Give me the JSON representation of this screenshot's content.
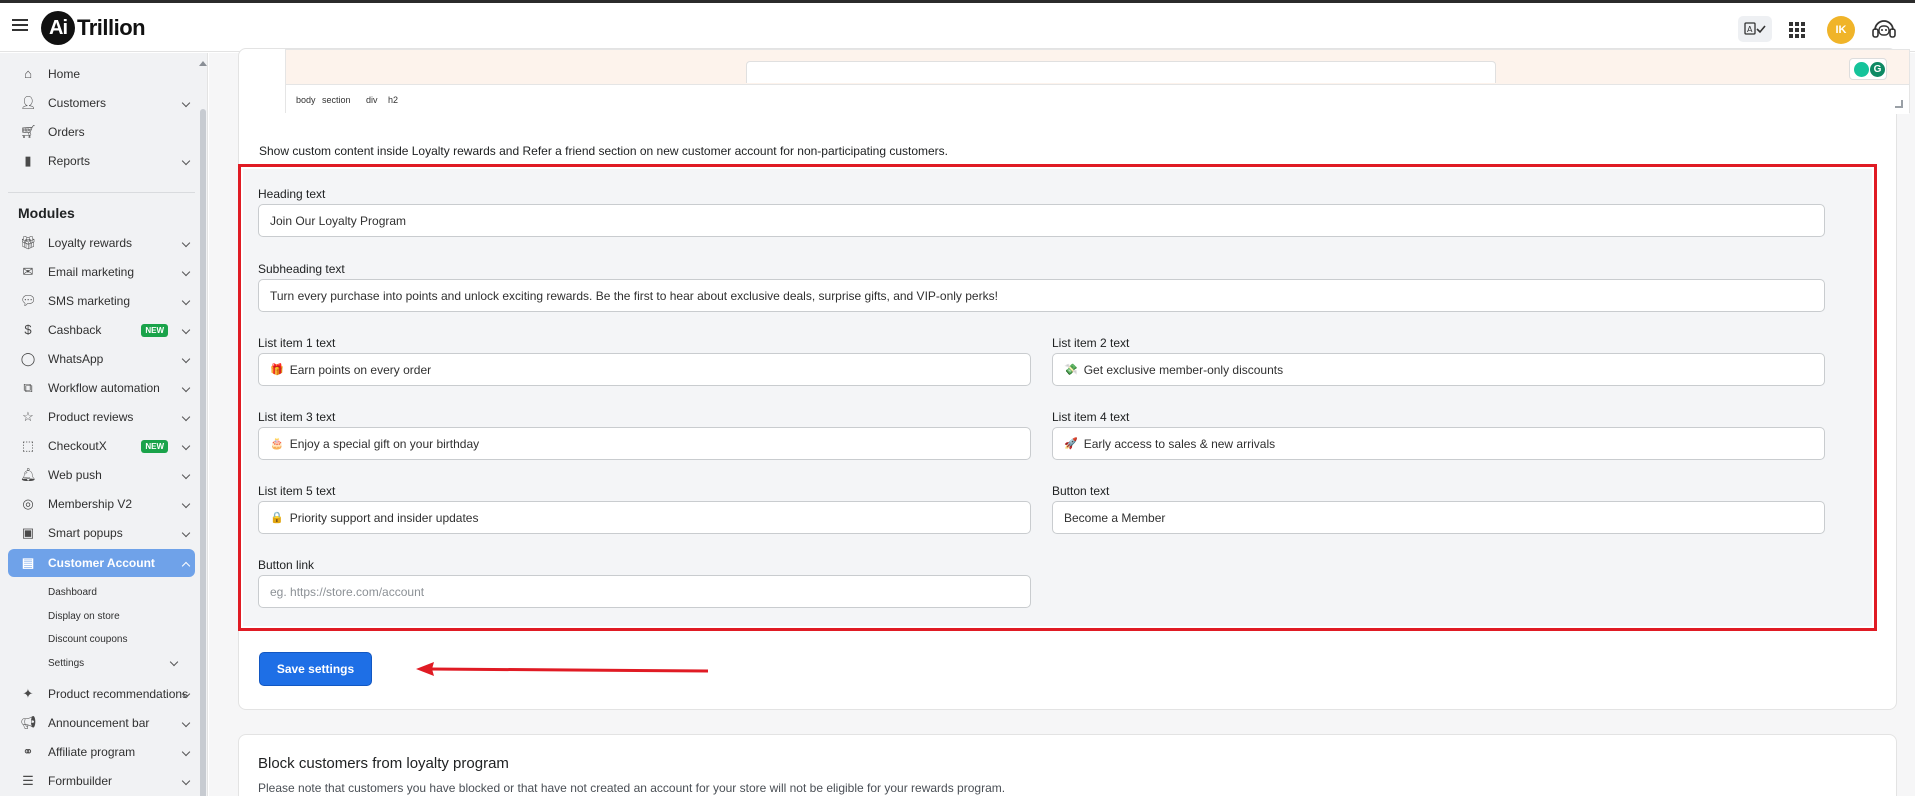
{
  "app": {
    "logo_mark": "Ai",
    "logo_text": "Trillion"
  },
  "topbar": {
    "avatar_initials": "IK",
    "translate_icon": "translate-check-icon",
    "apps_icon": "apps-grid-icon",
    "support_icon": "headset-icon"
  },
  "sidebar": {
    "main": [
      {
        "label": "Home",
        "icon": "home-icon",
        "has_chevron": false
      },
      {
        "label": "Customers",
        "icon": "user-icon",
        "has_chevron": true
      },
      {
        "label": "Orders",
        "icon": "cart-icon",
        "has_chevron": false
      },
      {
        "label": "Reports",
        "icon": "bar-chart-icon",
        "has_chevron": true
      }
    ],
    "modules_title": "Modules",
    "modules": [
      {
        "label": "Loyalty rewards",
        "icon": "gift-icon"
      },
      {
        "label": "Email marketing",
        "icon": "mail-icon"
      },
      {
        "label": "SMS marketing",
        "icon": "chat-icon"
      },
      {
        "label": "Cashback",
        "icon": "coin-icon",
        "badge": "NEW"
      },
      {
        "label": "WhatsApp",
        "icon": "whatsapp-icon"
      },
      {
        "label": "Workflow automation",
        "icon": "workflow-icon"
      },
      {
        "label": "Product reviews",
        "icon": "star-icon"
      },
      {
        "label": "CheckoutX",
        "icon": "checkout-icon",
        "badge": "NEW"
      },
      {
        "label": "Web push",
        "icon": "bell-icon"
      },
      {
        "label": "Membership V2",
        "icon": "badge-icon"
      },
      {
        "label": "Smart popups",
        "icon": "popup-icon"
      },
      {
        "label": "Customer Account",
        "icon": "id-card-icon",
        "active": true
      }
    ],
    "sub_items": [
      "Dashboard",
      "Display on store",
      "Discount coupons",
      "Settings"
    ],
    "modules_after": [
      {
        "label": "Product recommendations",
        "icon": "recommend-icon"
      },
      {
        "label": "Announcement bar",
        "icon": "megaphone-icon"
      },
      {
        "label": "Affiliate program",
        "icon": "network-icon"
      },
      {
        "label": "Formbuilder",
        "icon": "form-icon"
      }
    ]
  },
  "editor": {
    "path": [
      "body",
      "section",
      "div",
      "h2"
    ]
  },
  "description": "Show custom content inside Loyalty rewards and Refer a friend section on new customer account for non-participating customers.",
  "form": {
    "heading": {
      "label": "Heading text",
      "value": "Join Our Loyalty Program"
    },
    "subheading": {
      "label": "Subheading text",
      "value": "Turn every purchase into points and unlock exciting rewards. Be the first to hear about exclusive deals, surprise gifts, and VIP-only perks!"
    },
    "item1": {
      "label": "List item 1 text",
      "emoji": "🎁",
      "value": "Earn points on every order"
    },
    "item2": {
      "label": "List item 2 text",
      "emoji": "💸",
      "value": "Get exclusive member-only discounts"
    },
    "item3": {
      "label": "List item 3 text",
      "emoji": "🎂",
      "value": "Enjoy a special gift on your birthday"
    },
    "item4": {
      "label": "List item 4 text",
      "emoji": "🚀",
      "value": "Early access to sales & new arrivals"
    },
    "item5": {
      "label": "List item 5 text",
      "emoji": "🔒",
      "value": "Priority support and insider updates"
    },
    "button_text": {
      "label": "Button text",
      "value": "Become a Member"
    },
    "button_link": {
      "label": "Button link",
      "placeholder": "eg. https://store.com/account"
    }
  },
  "save_label": "Save settings",
  "block": {
    "title": "Block customers from loyalty program",
    "description": "Please note that customers you have blocked or that have not created an account for your store will not be eligible for your rewards program."
  },
  "colors": {
    "highlight": "#e01b24",
    "primary": "#1e6fe6",
    "active_nav": "#6fa2e9",
    "badge_new": "#1aa34a",
    "avatar": "#f0b429"
  }
}
